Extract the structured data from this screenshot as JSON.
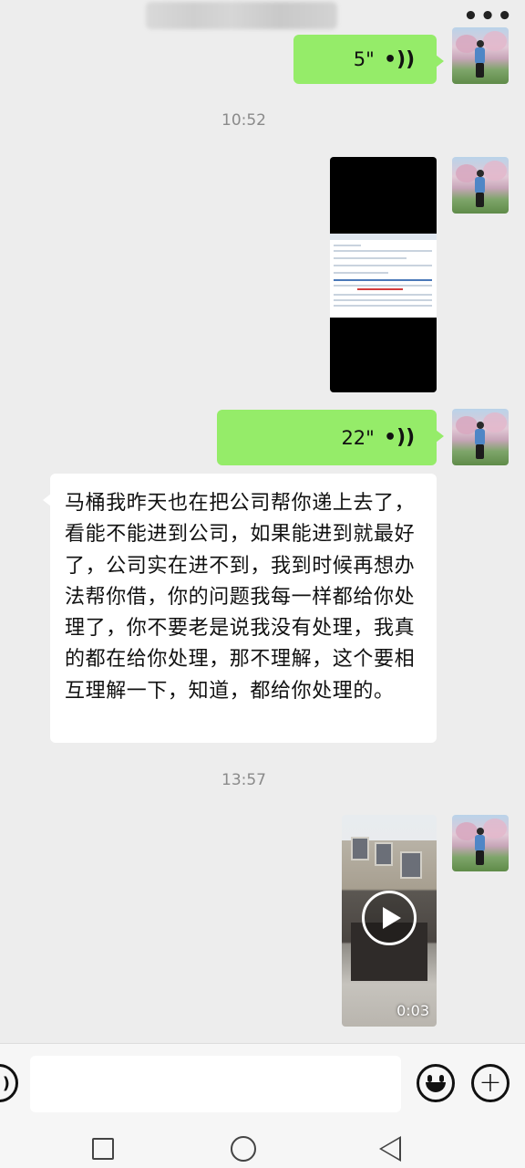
{
  "header": {
    "title_blurred": "",
    "more_icon": "more-icon"
  },
  "messages": [
    {
      "type": "voice",
      "side": "right",
      "duration": "5\""
    },
    {
      "type": "timestamp",
      "text": "10:52"
    },
    {
      "type": "image",
      "side": "right"
    },
    {
      "type": "voice",
      "side": "right",
      "duration": "22\""
    },
    {
      "type": "text",
      "side": "left",
      "text": "马桶我昨天也在把公司帮你递上去了，看能不能进到公司，如果能进到就最好了，公司实在进不到，我到时候再想办法帮你借，你的问题我每一样都给你处理了，你不要老是说我没有处理，我真的都在给你处理，那不理解，这个要相互理解一下，知道，都给你处理的。"
    },
    {
      "type": "timestamp",
      "text": "13:57"
    },
    {
      "type": "video",
      "side": "right",
      "duration": "0:03"
    }
  ],
  "input": {
    "value": "",
    "placeholder": ""
  },
  "colors": {
    "background": "#ededed",
    "bubble_self": "#95ec69",
    "bubble_other": "#ffffff",
    "timestamp": "#8a8a8a"
  }
}
